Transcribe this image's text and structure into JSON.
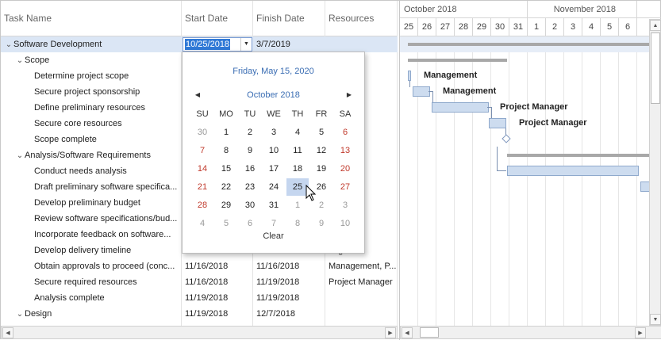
{
  "columns": {
    "task_name": "Task Name",
    "start_date": "Start Date",
    "finish_date": "Finish Date",
    "resources": "Resources"
  },
  "rows": [
    {
      "name": "Software Development",
      "start": "",
      "finish": "3/7/2019",
      "resources": "",
      "level": 0,
      "expand": "⌄",
      "selected": true
    },
    {
      "name": "Scope",
      "start": "",
      "finish": "",
      "resources": "",
      "level": 1,
      "expand": "⌄"
    },
    {
      "name": "Determine project scope",
      "start": "",
      "finish": "",
      "resources": "ent",
      "level": 2
    },
    {
      "name": "Secure project sponsorship",
      "start": "",
      "finish": "",
      "resources": "ent",
      "level": 2
    },
    {
      "name": "Define preliminary resources",
      "start": "",
      "finish": "",
      "resources": "nager",
      "level": 2
    },
    {
      "name": "Secure core resources",
      "start": "",
      "finish": "",
      "resources": "nager",
      "level": 2
    },
    {
      "name": "Scope complete",
      "start": "",
      "finish": "",
      "resources": "",
      "level": 2
    },
    {
      "name": "Analysis/Software Requirements",
      "start": "",
      "finish": "",
      "resources": "",
      "level": 1,
      "expand": "⌄"
    },
    {
      "name": "Conduct needs analysis",
      "start": "",
      "finish": "",
      "resources": "",
      "level": 2
    },
    {
      "name": "Draft preliminary software specifica...",
      "start": "",
      "finish": "",
      "resources": "",
      "level": 2
    },
    {
      "name": "Develop preliminary budget",
      "start": "",
      "finish": "",
      "resources": "nager",
      "level": 2
    },
    {
      "name": "Review software specifications/bud...",
      "start": "",
      "finish": "",
      "resources": "nage...",
      "level": 2
    },
    {
      "name": "Incorporate feedback on software...",
      "start": "",
      "finish": "",
      "resources": "",
      "level": 2
    },
    {
      "name": "Develop delivery timeline",
      "start": "",
      "finish": "",
      "resources": "nager",
      "level": 2
    },
    {
      "name": "Obtain approvals to proceed (conc...",
      "start": "11/16/2018",
      "finish": "11/16/2018",
      "resources": "Management, P...",
      "level": 2
    },
    {
      "name": "Secure required resources",
      "start": "11/16/2018",
      "finish": "11/19/2018",
      "resources": "Project Manager",
      "level": 2
    },
    {
      "name": "Analysis complete",
      "start": "11/19/2018",
      "finish": "11/19/2018",
      "resources": "",
      "level": 2
    },
    {
      "name": "Design",
      "start": "11/19/2018",
      "finish": "12/7/2018",
      "resources": "",
      "level": 1,
      "expand": "⌄"
    }
  ],
  "editor": {
    "value": "10/25/2018",
    "dropdown_glyph": "▼"
  },
  "calendar": {
    "today_label": "Friday, May 15, 2020",
    "month_label": "October 2018",
    "prev_glyph": "◀",
    "next_glyph": "▶",
    "weekdays": [
      "SU",
      "MO",
      "TU",
      "WE",
      "TH",
      "FR",
      "SA"
    ],
    "weeks": [
      [
        "30",
        "1",
        "2",
        "3",
        "4",
        "5",
        "6"
      ],
      [
        "7",
        "8",
        "9",
        "10",
        "11",
        "12",
        "13"
      ],
      [
        "14",
        "15",
        "16",
        "17",
        "18",
        "19",
        "20"
      ],
      [
        "21",
        "22",
        "23",
        "24",
        "25",
        "26",
        "27"
      ],
      [
        "28",
        "29",
        "30",
        "31",
        "1",
        "2",
        "3"
      ],
      [
        "4",
        "5",
        "6",
        "7",
        "8",
        "9",
        "10"
      ]
    ],
    "first_week_other_count": 1,
    "last_month_days_start_week": 4,
    "selected_day": "25",
    "clear_label": "Clear",
    "weekend_color": "#c0392b"
  },
  "gantt": {
    "months": [
      {
        "label": "October 2018"
      },
      {
        "label": "November 2018"
      }
    ],
    "days": [
      "25",
      "26",
      "27",
      "28",
      "29",
      "30",
      "31",
      "1",
      "2",
      "3",
      "4",
      "5",
      "6"
    ],
    "labels": [
      "Management",
      "Management",
      "Project Manager",
      "Project Manager"
    ]
  },
  "scrollbars": {
    "left_glyph": "◀",
    "right_glyph": "▶",
    "up_glyph": "▲",
    "down_glyph": "▼"
  },
  "colors": {
    "accent": "#3a6db3",
    "selection": "#dbe6f5",
    "task_bar": "#cddcef"
  }
}
